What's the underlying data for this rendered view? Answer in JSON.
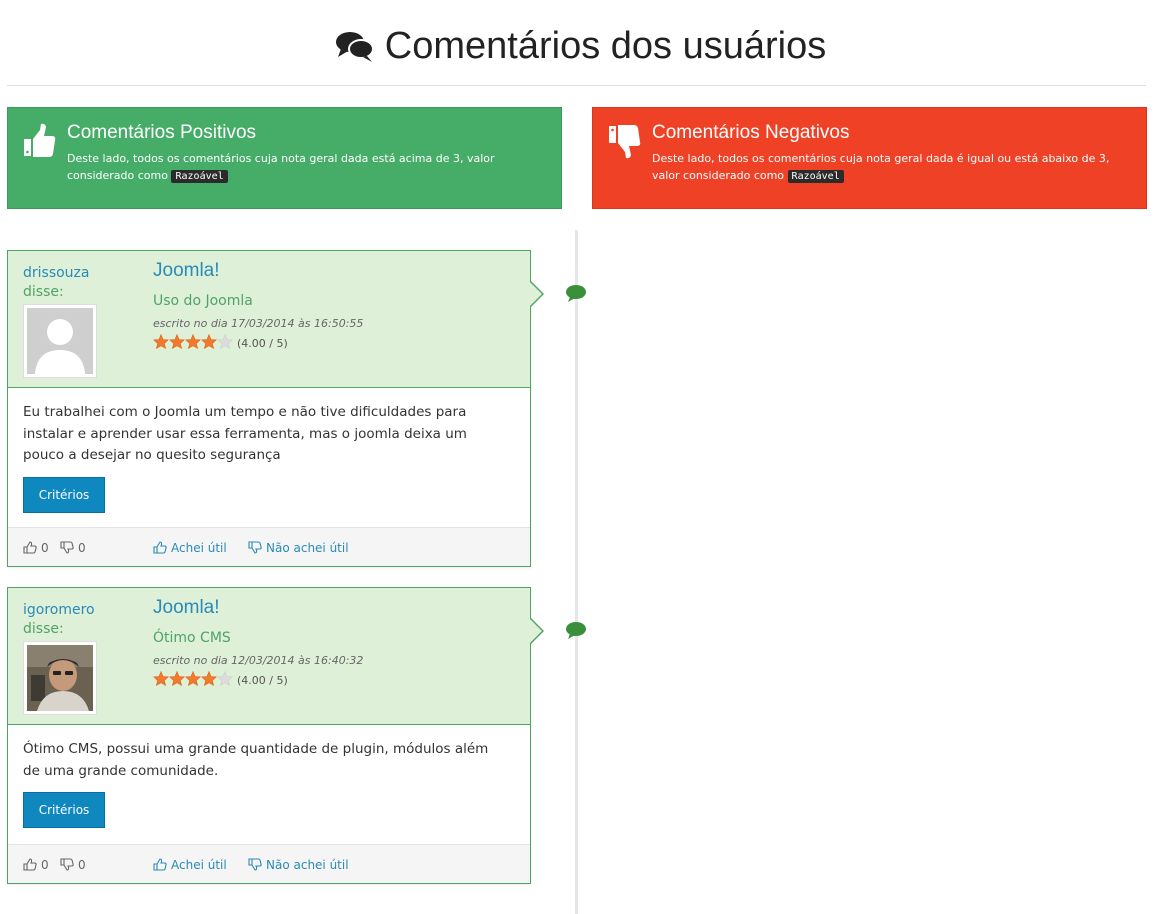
{
  "header": {
    "title": "Comentários dos usuários",
    "title_icon": "comments-icon"
  },
  "banners": {
    "positive": {
      "title": "Comentários Positivos",
      "desc_before": "Deste lado, todos os comentários cuja nota geral dada está acima de 3, valor considerado como",
      "code": "Razoável",
      "icon": "thumbs-up-icon",
      "color": "#46ad68"
    },
    "negative": {
      "title": "Comentários Negativos",
      "desc_before": "Deste lado, todos os comentários cuja nota geral dada é igual ou está abaixo de 3, valor considerado como",
      "code": "Razoável",
      "icon": "thumbs-down-icon",
      "color": "#ef4125"
    }
  },
  "reviews": [
    {
      "user": "drissouza",
      "said": "disse:",
      "avatar": "default-avatar",
      "product": "Joomla!",
      "title": "Uso do Joomla",
      "date": "escrito no dia 17/03/2014 às 16:50:55",
      "rating": 4,
      "rating_text": "(4.00 / 5)",
      "text": "Eu trabalhei com o Joomla um tempo e não tive dificuldades para instalar e aprender usar essa ferramenta, mas o joomla deixa um pouco a desejar no quesito segurança",
      "criteria_label": "Critérios",
      "likes": "0",
      "dislikes": "0",
      "useful_label": "Achei útil",
      "not_useful_label": "Não achei útil"
    },
    {
      "user": "igoromero",
      "said": "disse:",
      "avatar": "user-photo",
      "product": "Joomla!",
      "title": "Ótimo CMS",
      "date": "escrito no dia 12/03/2014 às 16:40:32",
      "rating": 4,
      "rating_text": "(4.00 / 5)",
      "text": "Ótimo CMS, possui uma grande quantidade de plugin, módulos além de uma grande comunidade.",
      "criteria_label": "Critérios",
      "likes": "0",
      "dislikes": "0",
      "useful_label": "Achei útil",
      "not_useful_label": "Não achei útil"
    }
  ]
}
